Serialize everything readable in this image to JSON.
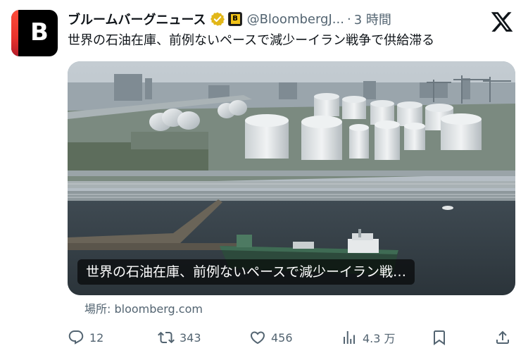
{
  "account": {
    "name": "ブルームバーグニュース",
    "handle": "@BloombergJ...",
    "separator": "·",
    "time": "3 時間",
    "avatar_letter": "B",
    "org_badge_letter": "B"
  },
  "tweet": {
    "text": "世界の石油在庫、前例ないペースで減少ーイラン戦争で供給滞る"
  },
  "card": {
    "title": "世界の石油在庫、前例ないペースで減少ーイラン戦…",
    "source": "場所: bloomberg.com",
    "image_description_icon": "photo"
  },
  "actions": {
    "reply_count": "12",
    "retweet_count": "343",
    "like_count": "456",
    "view_count": "4.3 万"
  },
  "icons": {
    "verified": "verified-gold-badge-icon",
    "x_logo": "x-logo-icon",
    "reply": "reply-icon",
    "retweet": "retweet-icon",
    "like": "heart-icon",
    "views": "views-bar-chart-icon",
    "bookmark": "bookmark-icon",
    "share": "share-icon"
  },
  "colors": {
    "text": "#0f1419",
    "secondary": "#536471",
    "verified_gold": "#e2b719",
    "avatar_red": "#e8322c"
  }
}
